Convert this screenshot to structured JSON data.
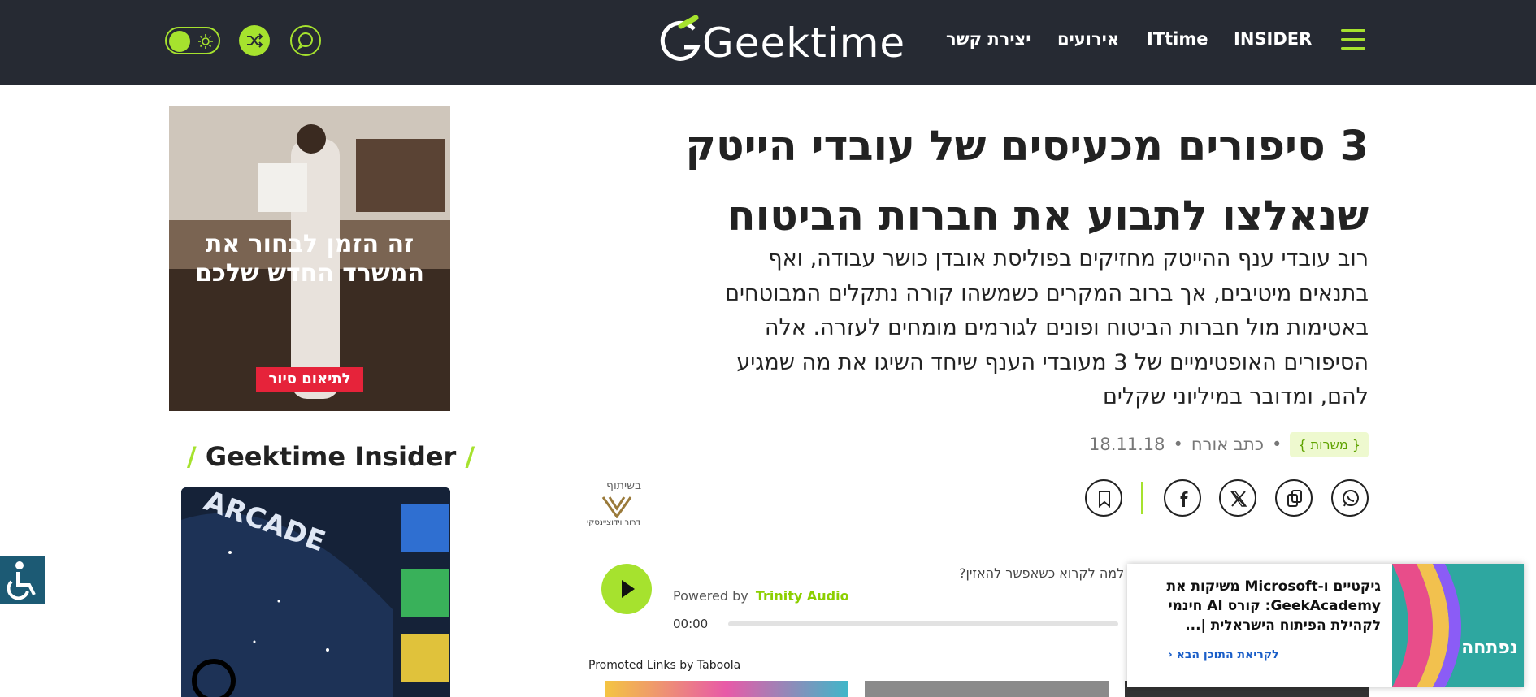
{
  "header": {
    "logo_text": "Geektime",
    "nav": [
      "INSIDER",
      "ITtime",
      "אירועים",
      "יצירת קשר"
    ]
  },
  "article": {
    "title_line1": "3 סיפורים מכעיסים של עובדי הייטק",
    "title_line2": "שנאלצו לתבוע את חברות הביטוח",
    "subtitle_lines": [
      "רוב עובדי ענף ההייטק מחזיקים בפוליסת אובדן כושר עבודה, ואף",
      "בתנאים מיטיבים, אך ברוב המקרים כשמשהו קורה נתקלים המבוטחים",
      "באטימות מול חברות הביטוח ופונים לגורמים מומחים לעזרה. אלה",
      "הסיפורים האופטימיים של 3 מעובדי הענף שיחד השיגו את מה שמגיע",
      "להם, ומדובר במיליוני שקלים"
    ],
    "tag": "{ משרות }",
    "author": "כתב אורח",
    "date": "18.11.18",
    "sep": "•"
  },
  "partner": {
    "label": "בשיתוף",
    "name": "דרור וידוציינסקי"
  },
  "audio": {
    "prompt": "למה לקרוא כשאפשר להאזין?",
    "powered_by": "Powered by",
    "brand": "Trinity Audio",
    "time": "00:00"
  },
  "promoted": "Promoted Links by Taboola",
  "sidebar": {
    "ad_line1": "זה הזמן לבחור את",
    "ad_line2": "המשרד החדש שלכם",
    "ad_button": "לתיאום סיור",
    "insider_title": "Geektime Insider",
    "slash": "/"
  },
  "popup": {
    "title": "גיקטיים ו-Microsoft משיקות את GeekAcademy: קורס AI חינמי לקהילת הפיתוח הישראלית |...",
    "link": "לקריאת התוכן הבא",
    "image_text": "נפתחה"
  },
  "colors": {
    "accent": "#a6e22e",
    "topbar": "#262a33"
  }
}
